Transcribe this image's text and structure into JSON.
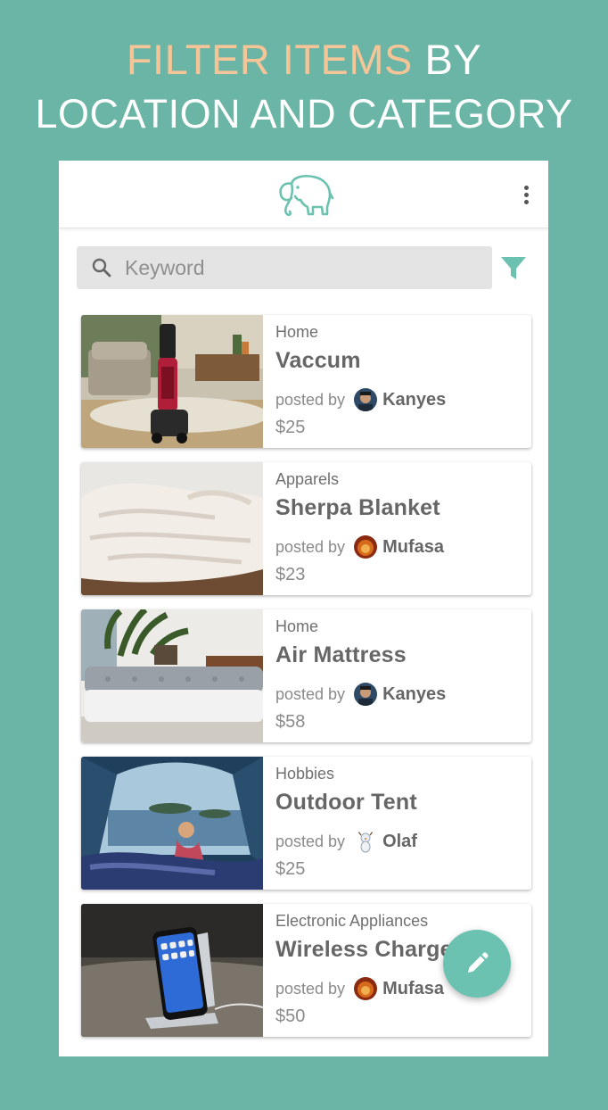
{
  "promo": {
    "highlight": "FILTER ITEMS",
    "rest_line1": "BY",
    "line2": "LOCATION AND CATEGORY"
  },
  "colors": {
    "background": "#6ab5a5",
    "highlight_text": "#f5c497",
    "accent": "#6cc2b0"
  },
  "appbar": {
    "logo_icon": "elephant-logo-icon",
    "menu_icon": "more-vertical-icon"
  },
  "search": {
    "placeholder": "Keyword",
    "value": "",
    "search_icon": "search-icon",
    "filter_icon": "filter-funnel-icon"
  },
  "listings": [
    {
      "category": "Home",
      "title": "Vaccum",
      "posted_by_label": "posted by",
      "user": "Kanyes",
      "price": "$25"
    },
    {
      "category": "Apparels",
      "title": "Sherpa Blanket",
      "posted_by_label": "posted by",
      "user": "Mufasa",
      "price": "$23"
    },
    {
      "category": "Home",
      "title": "Air Mattress",
      "posted_by_label": "posted by",
      "user": "Kanyes",
      "price": "$58"
    },
    {
      "category": "Hobbies",
      "title": "Outdoor Tent",
      "posted_by_label": "posted by",
      "user": "Olaf",
      "price": "$25"
    },
    {
      "category": "Electronic Appliances",
      "title": "Wireless Charger",
      "posted_by_label": "posted by",
      "user": "Mufasa",
      "price": "$50"
    }
  ],
  "fab": {
    "icon": "pencil-icon"
  }
}
